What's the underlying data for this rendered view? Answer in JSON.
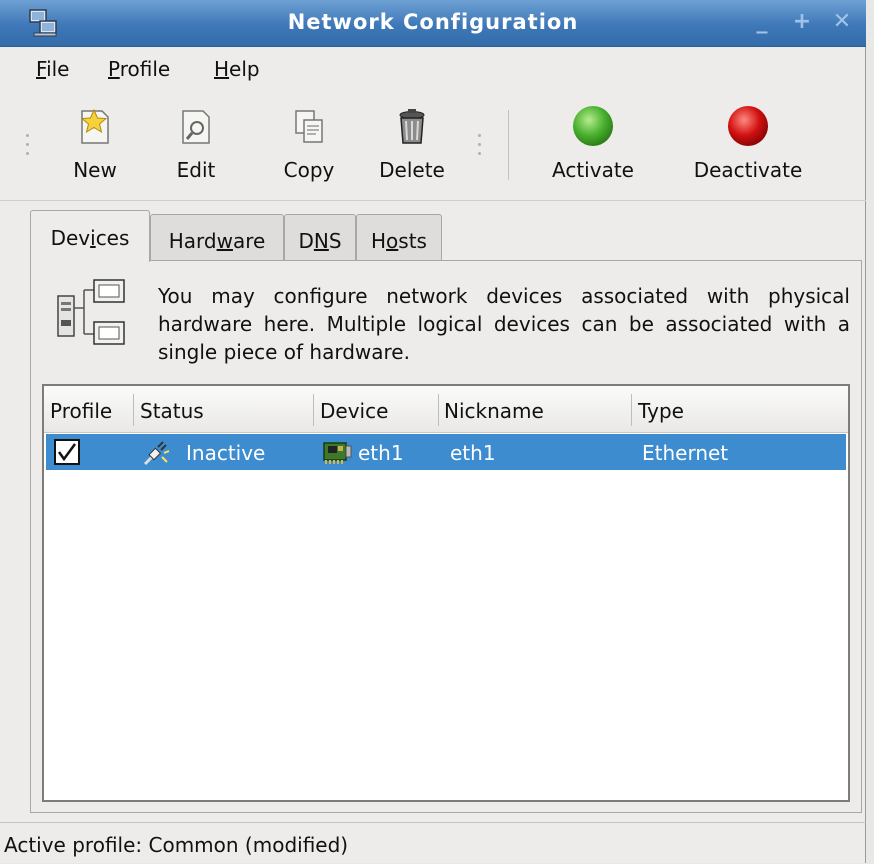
{
  "window": {
    "title": "Network Configuration",
    "minimize_glyph": "_",
    "maximize_glyph": "+",
    "close_glyph": "✕"
  },
  "menu": {
    "file": {
      "mnemonic": "F",
      "rest": "ile"
    },
    "profile": {
      "mnemonic": "P",
      "rest": "rofile"
    },
    "help": {
      "mnemonic": "H",
      "rest": "elp"
    }
  },
  "toolbar": {
    "new_label": "New",
    "edit_label": "Edit",
    "copy_label": "Copy",
    "delete_label": "Delete",
    "activate_label": "Activate",
    "deactivate_label": "Deactivate"
  },
  "tabs": {
    "devices": {
      "pre": "Dev",
      "mnemonic": "i",
      "post": "ces"
    },
    "hardware": {
      "pre": "Hard",
      "mnemonic": "w",
      "post": "are"
    },
    "dns": {
      "pre": "D",
      "mnemonic": "N",
      "post": "S"
    },
    "hosts": {
      "pre": "H",
      "mnemonic": "o",
      "post": "sts"
    }
  },
  "description": "You may configure network devices associated with physical hardware here.  Multiple logical devices can be associated with a single piece of hardware.",
  "device_list": {
    "columns": {
      "profile": "Profile",
      "status": "Status",
      "device": "Device",
      "nickname": "Nickname",
      "type": "Type"
    },
    "rows": [
      {
        "profile_checked": true,
        "status": "Inactive",
        "device": "eth1",
        "nickname": "eth1",
        "type": "Ethernet"
      }
    ]
  },
  "statusbar": {
    "text": "Active profile: Common (modified)"
  },
  "colors": {
    "titlebar": "#3f78b8",
    "selection": "#3d8ccf",
    "activate_green": "#49b02e",
    "deactivate_red": "#d01010"
  }
}
